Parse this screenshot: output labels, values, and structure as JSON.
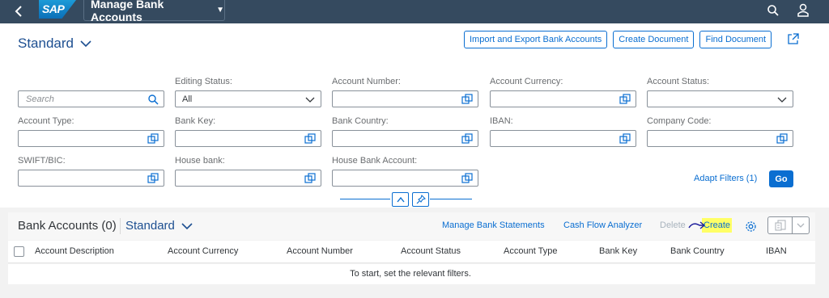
{
  "shell": {
    "logo": "SAP",
    "app_title": "Manage Bank Accounts"
  },
  "header": {
    "variant": "Standard",
    "actions": [
      "Import and Export Bank Accounts",
      "Create Document",
      "Find Document"
    ]
  },
  "filters": {
    "search_placeholder": "Search",
    "editing_status": {
      "label": "Editing Status:",
      "value": "All"
    },
    "account_number": {
      "label": "Account Number:"
    },
    "account_currency": {
      "label": "Account Currency:"
    },
    "account_status": {
      "label": "Account Status:"
    },
    "account_type": {
      "label": "Account Type:"
    },
    "bank_key": {
      "label": "Bank Key:"
    },
    "bank_country": {
      "label": "Bank Country:"
    },
    "iban": {
      "label": "IBAN:"
    },
    "company_code": {
      "label": "Company Code:"
    },
    "swift_bic": {
      "label": "SWIFT/BIC:"
    },
    "house_bank": {
      "label": "House bank:"
    },
    "house_bank_account": {
      "label": "House Bank Account:"
    },
    "adapt_filters": "Adapt Filters (1)",
    "go": "Go"
  },
  "table": {
    "title": "Bank Accounts (0)",
    "variant": "Standard",
    "toolbar": {
      "manage_statements": "Manage Bank Statements",
      "cash_flow": "Cash Flow Analyzer",
      "delete": "Delete",
      "create": "Create"
    },
    "columns": [
      "Account Description",
      "Account Currency",
      "Account Number",
      "Account Status",
      "Account Type",
      "Bank Key",
      "Bank Country",
      "IBAN"
    ],
    "no_data": "To start, set the relevant filters."
  },
  "colors": {
    "shell": "#354a5f",
    "accent": "#0a6ed1",
    "highlight": "#ffff66"
  }
}
